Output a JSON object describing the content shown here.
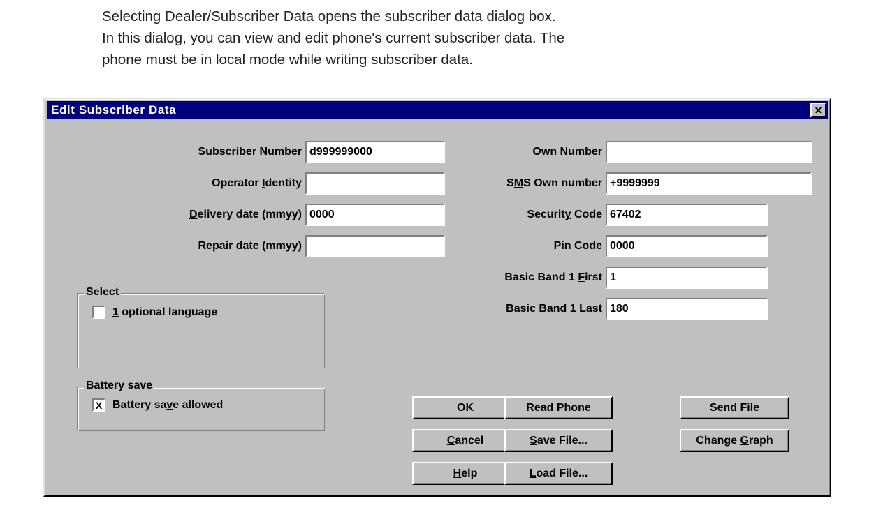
{
  "intro": {
    "paragraph": "Selecting Dealer/Subscriber Data opens the subscriber data dialog box.\nIn this dialog, you can view and edit phone's current subscriber data. The\nphone must be in local mode while writing subscriber data."
  },
  "colors": {
    "titlebar": "#00007f",
    "dialog_face": "#c0c0c0",
    "field_bg": "#ffffff",
    "text": "#000000"
  },
  "dialog": {
    "title": "Edit Subscriber Data",
    "close_label": "✕",
    "close_icon": "close-icon",
    "left_fields": [
      {
        "label_pre": "S",
        "label_accel": "u",
        "label_post": "bscriber Number",
        "value": "d999999000",
        "name": "subscriber-number"
      },
      {
        "label_pre": "Operator ",
        "label_accel": "I",
        "label_post": "dentity",
        "value": "",
        "name": "operator-identity"
      },
      {
        "label_pre": "",
        "label_accel": "D",
        "label_post": "elivery date (mmyy)",
        "value": "0000",
        "name": "delivery-date"
      },
      {
        "label_pre": "Rep",
        "label_accel": "a",
        "label_post": "ir date (mmyy)",
        "value": "",
        "name": "repair-date"
      }
    ],
    "right_fields": [
      {
        "label_pre": "Own Num",
        "label_accel": "b",
        "label_post": "er",
        "value": "",
        "name": "own-number"
      },
      {
        "label_pre": "S",
        "label_accel": "M",
        "label_post": "S Own number",
        "value": "+9999999",
        "name": "sms-own-number"
      },
      {
        "label_pre": "Securit",
        "label_accel": "y",
        "label_post": " Code",
        "value": "67402",
        "name": "security-code"
      },
      {
        "label_pre": "Pi",
        "label_accel": "n",
        "label_post": " Code",
        "value": "0000",
        "name": "pin-code"
      },
      {
        "label_pre": "Basic Band 1 ",
        "label_accel": "F",
        "label_post": "irst",
        "value": "1",
        "name": "basic-band-1-first"
      },
      {
        "label_pre": "B",
        "label_accel": "a",
        "label_post": "sic Band 1 Last",
        "value": "180",
        "name": "basic-band-1-last"
      }
    ],
    "select_group": {
      "title": "Select",
      "checkbox": {
        "pre": "",
        "accel": "1",
        "post": " optional language",
        "checked": false,
        "mark": ""
      }
    },
    "battery_group": {
      "title": "Battery save",
      "checkbox": {
        "pre": "Battery sa",
        "accel": "v",
        "post": "e allowed",
        "checked": true,
        "mark": "X"
      }
    },
    "buttons": [
      {
        "pre": "",
        "accel": "O",
        "post": "K",
        "name": "ok-button",
        "col": 0,
        "row": 0
      },
      {
        "pre": "",
        "accel": "C",
        "post": "ancel",
        "name": "cancel-button",
        "col": 0,
        "row": 1
      },
      {
        "pre": "",
        "accel": "H",
        "post": "elp",
        "name": "help-button",
        "col": 0,
        "row": 2
      },
      {
        "pre": "",
        "accel": "R",
        "post": "ead Phone",
        "name": "read-phone-button",
        "col": 1,
        "row": 0
      },
      {
        "pre": "",
        "accel": "S",
        "post": "ave File...",
        "name": "save-file-button",
        "col": 1,
        "row": 1
      },
      {
        "pre": "",
        "accel": "L",
        "post": "oad File...",
        "name": "load-file-button",
        "col": 1,
        "row": 2
      },
      {
        "pre": "S",
        "accel": "e",
        "post": "nd File",
        "name": "send-file-button",
        "col": 2,
        "row": 0
      },
      {
        "pre": "Change ",
        "accel": "G",
        "post": "raph",
        "name": "change-graph-button",
        "col": 2,
        "row": 1
      }
    ]
  }
}
